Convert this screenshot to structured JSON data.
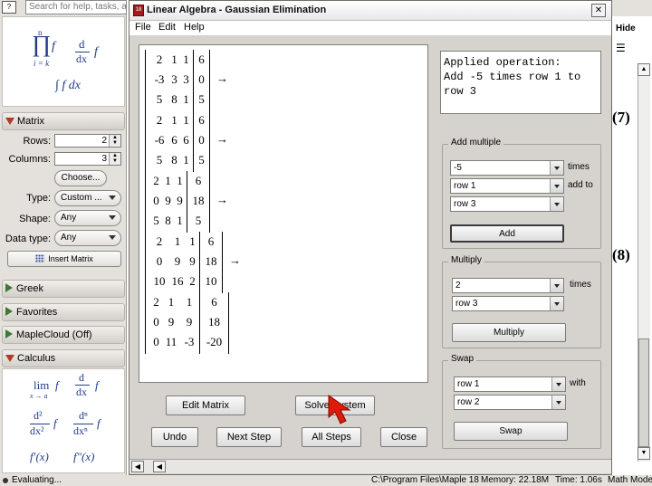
{
  "search": {
    "placeholder": "Search for help, tasks, a"
  },
  "palette": {
    "expressions": {
      "product": "∏",
      "product_lower": "i = k",
      "product_upper": "n",
      "deriv_num": "d",
      "deriv_den": "dx",
      "f": "f",
      "integral": "∫ f dx"
    },
    "matrix": {
      "title": "Matrix",
      "rows_label": "Rows:",
      "rows_value": "2",
      "columns_label": "Columns:",
      "columns_value": "3",
      "choose_label": "Choose...",
      "type_label": "Type:",
      "type_value": "Custom ...",
      "shape_label": "Shape:",
      "shape_value": "Any",
      "datatype_label": "Data type:",
      "datatype_value": "Any",
      "insert_label": "Insert Matrix"
    },
    "sections": [
      "Greek",
      "Favorites",
      "MapleCloud (Off)"
    ],
    "calculus": {
      "title": "Calculus",
      "lim": "lim",
      "lim_sub": "x → a",
      "d": "d",
      "dx": "dx",
      "d2": "d²",
      "dx2": "dx²",
      "dn": "dⁿ",
      "dxn": "dxⁿ",
      "fprime": "f′(x)",
      "fdprime": "f″(x)"
    }
  },
  "dialog": {
    "title": "Linear Algebra - Gaussian Elimination",
    "close_glyph": "✕",
    "menu": [
      "File",
      "Edit",
      "Help"
    ],
    "operation_text": [
      "Applied operation:",
      "Add -5 times row 1 to",
      "row 3"
    ],
    "matrices": [
      {
        "rows": [
          [
            "2",
            "1",
            "1",
            "6"
          ],
          [
            "-3",
            "3",
            "3",
            "0"
          ],
          [
            "5",
            "8",
            "1",
            "5"
          ]
        ],
        "arrow": true
      },
      {
        "rows": [
          [
            "2",
            "1",
            "1",
            "6"
          ],
          [
            "-6",
            "6",
            "6",
            "0"
          ],
          [
            "5",
            "8",
            "1",
            "5"
          ]
        ],
        "arrow": true
      },
      {
        "rows": [
          [
            "2",
            "1",
            "1",
            "6"
          ],
          [
            "0",
            "9",
            "9",
            "18"
          ],
          [
            "5",
            "8",
            "1",
            "5"
          ]
        ],
        "arrow": true
      },
      {
        "rows": [
          [
            "2",
            "1",
            "1",
            "6"
          ],
          [
            "0",
            "9",
            "9",
            "18"
          ],
          [
            "10",
            "16",
            "2",
            "10"
          ]
        ],
        "arrow": true
      },
      {
        "rows": [
          [
            "2",
            "1",
            "1",
            "6"
          ],
          [
            "0",
            "9",
            "9",
            "18"
          ],
          [
            "0",
            "11",
            "-3",
            "-20"
          ]
        ],
        "arrow": false
      }
    ],
    "arrow_glyph": "→",
    "add_multiple": {
      "title": "Add multiple",
      "factor": "-5",
      "times": "times",
      "source": "row 1",
      "add_to": "add to",
      "target": "row 3",
      "button": "Add"
    },
    "multiply": {
      "title": "Multiply",
      "factor": "2",
      "times": "times",
      "row": "row 3",
      "button": "Multiply"
    },
    "swap": {
      "title": "Swap",
      "row_a": "row 1",
      "with": "with",
      "row_b": "row 2",
      "button": "Swap"
    },
    "buttons": {
      "edit_matrix": "Edit Matrix",
      "solve_system": "Solve System",
      "undo": "Undo",
      "next_step": "Next Step",
      "all_steps": "All Steps",
      "close": "Close"
    }
  },
  "right": {
    "hide": "Hide",
    "eq7": "(7)",
    "eq8": "(8)"
  },
  "status": {
    "left": "Evaluating...",
    "path": "C:\\Program Files\\Maple 18",
    "memory": "Memory: 22.18M",
    "time": "Time: 1.06s",
    "mode": "Math Mode"
  },
  "colors": {
    "accent_red": "#b23a2a",
    "math_blue": "#213c8c",
    "cursor": "#e01a0a"
  }
}
